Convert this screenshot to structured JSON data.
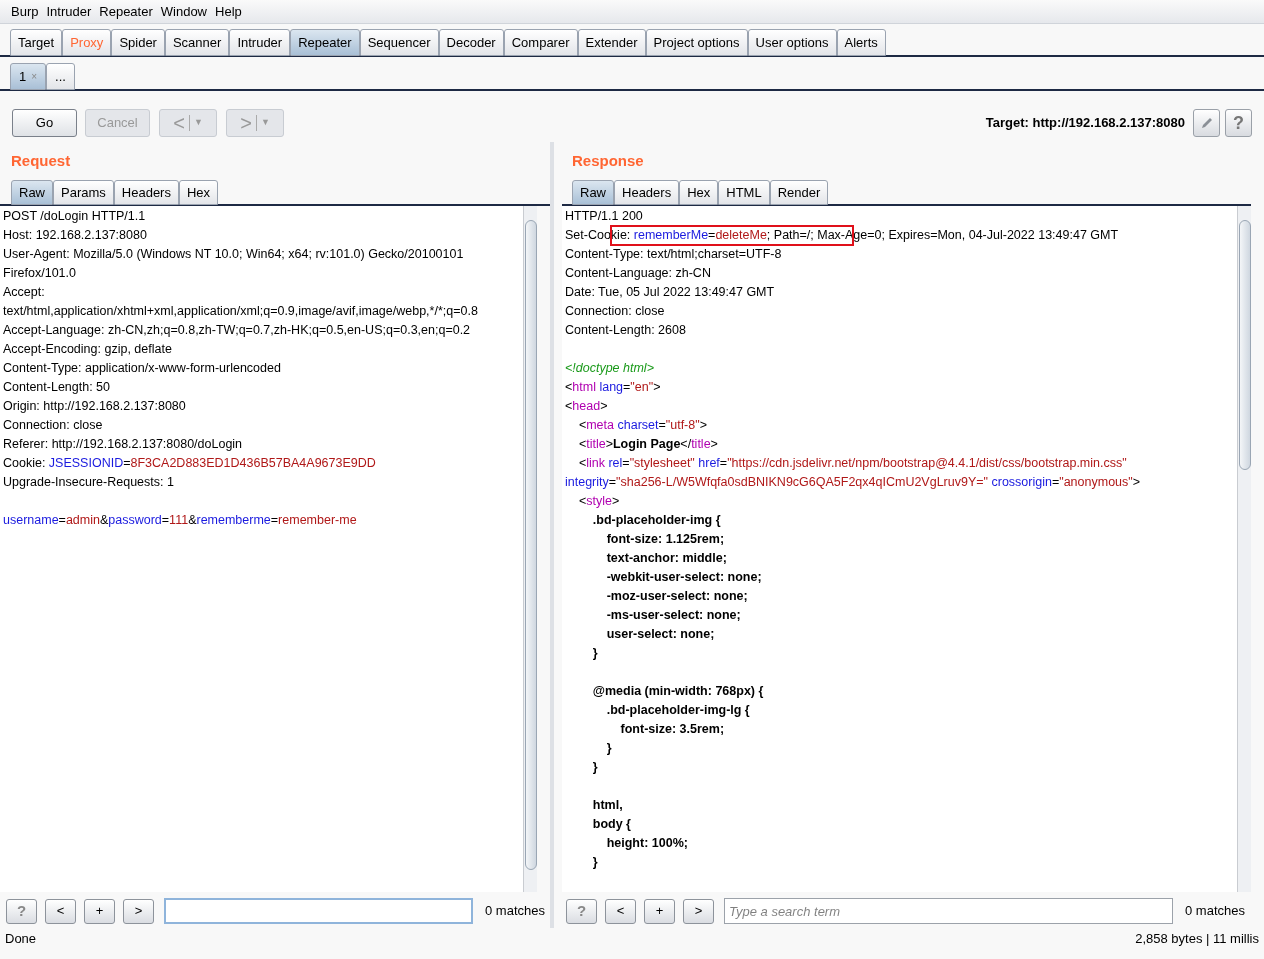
{
  "menu": [
    "Burp",
    "Intruder",
    "Repeater",
    "Window",
    "Help"
  ],
  "tabs": [
    {
      "label": "Target",
      "selected": false,
      "highlighted": false
    },
    {
      "label": "Proxy",
      "selected": false,
      "highlighted": true
    },
    {
      "label": "Spider",
      "selected": false,
      "highlighted": false
    },
    {
      "label": "Scanner",
      "selected": false,
      "highlighted": false
    },
    {
      "label": "Intruder",
      "selected": false,
      "highlighted": false
    },
    {
      "label": "Repeater",
      "selected": true,
      "highlighted": false
    },
    {
      "label": "Sequencer",
      "selected": false,
      "highlighted": false
    },
    {
      "label": "Decoder",
      "selected": false,
      "highlighted": false
    },
    {
      "label": "Comparer",
      "selected": false,
      "highlighted": false
    },
    {
      "label": "Extender",
      "selected": false,
      "highlighted": false
    },
    {
      "label": "Project options",
      "selected": false,
      "highlighted": false
    },
    {
      "label": "User options",
      "selected": false,
      "highlighted": false
    },
    {
      "label": "Alerts",
      "selected": false,
      "highlighted": false
    }
  ],
  "repeater_tabs": [
    {
      "label": "1",
      "close": "×",
      "selected": true
    },
    {
      "label": "...",
      "selected": false
    }
  ],
  "toolbar": {
    "go": {
      "label": "Go",
      "disabled": false
    },
    "cancel": {
      "label": "Cancel",
      "disabled": true
    },
    "back": {
      "arrow": "<",
      "caret": "▼",
      "disabled": true
    },
    "forward": {
      "arrow": ">",
      "caret": "▼",
      "disabled": true
    },
    "target": "Target: http://192.168.2.137:8080",
    "help": "?"
  },
  "request": {
    "title": "Request",
    "tabs": [
      {
        "label": "Raw",
        "selected": true
      },
      {
        "label": "Params",
        "selected": false
      },
      {
        "label": "Headers",
        "selected": false
      },
      {
        "label": "Hex",
        "selected": false
      }
    ],
    "lines": [
      {
        "kind": "code",
        "segments": [
          {
            "kind": "plain",
            "text": "POST /doLogin HTTP/1.1"
          }
        ]
      },
      {
        "kind": "code",
        "segments": [
          {
            "kind": "plain",
            "text": "Host: 192.168.2.137:8080"
          }
        ]
      },
      {
        "kind": "code",
        "segments": [
          {
            "kind": "plain",
            "text": "User-Agent: Mozilla/5.0 (Windows NT 10.0; Win64; x64; rv:101.0) Gecko/20100101"
          }
        ]
      },
      {
        "kind": "code",
        "segments": [
          {
            "kind": "plain",
            "text": "Firefox/101.0"
          }
        ]
      },
      {
        "kind": "code",
        "segments": [
          {
            "kind": "plain",
            "text": "Accept:"
          }
        ]
      },
      {
        "kind": "code",
        "segments": [
          {
            "kind": "plain",
            "text": "text/html,application/xhtml+xml,application/xml;q=0.9,image/avif,image/webp,*/*;q=0.8"
          }
        ]
      },
      {
        "kind": "code",
        "segments": [
          {
            "kind": "plain",
            "text": "Accept-Language: zh-CN,zh;q=0.8,zh-TW;q=0.7,zh-HK;q=0.5,en-US;q=0.3,en;q=0.2"
          }
        ]
      },
      {
        "kind": "code",
        "segments": [
          {
            "kind": "plain",
            "text": "Accept-Encoding: gzip, deflate"
          }
        ]
      },
      {
        "kind": "code",
        "segments": [
          {
            "kind": "plain",
            "text": "Content-Type: application/x-www-form-urlencoded"
          }
        ]
      },
      {
        "kind": "code",
        "segments": [
          {
            "kind": "plain",
            "text": "Content-Length: 50"
          }
        ]
      },
      {
        "kind": "code",
        "segments": [
          {
            "kind": "plain",
            "text": "Origin: http://192.168.2.137:8080"
          }
        ]
      },
      {
        "kind": "code",
        "segments": [
          {
            "kind": "plain",
            "text": "Connection: close"
          }
        ]
      },
      {
        "kind": "code",
        "segments": [
          {
            "kind": "plain",
            "text": "Referer: http://192.168.2.137:8080/doLogin"
          }
        ]
      },
      {
        "kind": "code",
        "segments": [
          {
            "kind": "plain",
            "text": "Cookie: "
          },
          {
            "kind": "name",
            "text": "JSESSIONID"
          },
          {
            "kind": "plain",
            "text": "="
          },
          {
            "kind": "value",
            "text": "8F3CA2D883ED1D436B57BA4A9673E9DD"
          }
        ]
      },
      {
        "kind": "code",
        "segments": [
          {
            "kind": "plain",
            "text": "Upgrade-Insecure-Requests: 1"
          }
        ]
      },
      {
        "kind": "blank"
      },
      {
        "kind": "code",
        "segments": [
          {
            "kind": "name",
            "text": "username"
          },
          {
            "kind": "plain",
            "text": "="
          },
          {
            "kind": "value",
            "text": "admin"
          },
          {
            "kind": "plain",
            "text": "&"
          },
          {
            "kind": "name",
            "text": "password"
          },
          {
            "kind": "plain",
            "text": "="
          },
          {
            "kind": "value",
            "text": "111"
          },
          {
            "kind": "plain",
            "text": "&"
          },
          {
            "kind": "name",
            "text": "rememberme"
          },
          {
            "kind": "plain",
            "text": "="
          },
          {
            "kind": "value",
            "text": "remember-me"
          }
        ]
      }
    ],
    "search": {
      "buttons": [
        "?",
        "<",
        "+",
        ">"
      ],
      "focused": true,
      "matches": "0 matches"
    }
  },
  "response": {
    "title": "Response",
    "tabs": [
      {
        "label": "Raw",
        "selected": true
      },
      {
        "label": "Headers",
        "selected": false
      },
      {
        "label": "Hex",
        "selected": false
      },
      {
        "label": "HTML",
        "selected": false
      },
      {
        "label": "Render",
        "selected": false
      }
    ],
    "lines": [
      {
        "kind": "code",
        "boxed": false,
        "segments": [
          {
            "kind": "plain",
            "text": "HTTP/1.1 200"
          }
        ]
      },
      {
        "kind": "code",
        "boxed": true,
        "segments": [
          {
            "kind": "plain",
            "text": "Set-Cookie: "
          },
          {
            "kind": "name",
            "text": "rememberMe"
          },
          {
            "kind": "plain",
            "text": "="
          },
          {
            "kind": "value",
            "text": "deleteMe"
          },
          {
            "kind": "plain",
            "text": "; Path=/; Max-Age=0; Expires=Mon, 04-Jul-2022 13:49:47 GMT"
          }
        ]
      },
      {
        "kind": "code",
        "boxed": false,
        "segments": [
          {
            "kind": "plain",
            "text": "Content-Type: text/html;charset=UTF-8"
          }
        ]
      },
      {
        "kind": "code",
        "boxed": false,
        "segments": [
          {
            "kind": "plain",
            "text": "Content-Language: zh-CN"
          }
        ]
      },
      {
        "kind": "code",
        "boxed": false,
        "segments": [
          {
            "kind": "plain",
            "text": "Date: Tue, 05 Jul 2022 13:49:47 GMT"
          }
        ]
      },
      {
        "kind": "code",
        "boxed": false,
        "segments": [
          {
            "kind": "plain",
            "text": "Connection: close"
          }
        ]
      },
      {
        "kind": "code",
        "boxed": false,
        "segments": [
          {
            "kind": "plain",
            "text": "Content-Length: 2608"
          }
        ]
      },
      {
        "kind": "blank"
      },
      {
        "kind": "code",
        "boxed": false,
        "segments": [
          {
            "kind": "comment",
            "text": "<!doctype html>"
          }
        ]
      },
      {
        "kind": "code",
        "boxed": false,
        "segments": [
          {
            "kind": "plain",
            "text": "<"
          },
          {
            "kind": "tag",
            "text": "html"
          },
          {
            "kind": "name",
            "text": " lang"
          },
          {
            "kind": "plain",
            "text": "="
          },
          {
            "kind": "value",
            "text": "\"en\""
          },
          {
            "kind": "plain",
            "text": ">"
          }
        ]
      },
      {
        "kind": "code",
        "boxed": false,
        "segments": [
          {
            "kind": "plain",
            "text": "<"
          },
          {
            "kind": "tag",
            "text": "head"
          },
          {
            "kind": "plain",
            "text": ">"
          }
        ]
      },
      {
        "kind": "code",
        "boxed": false,
        "segments": [
          {
            "kind": "plain",
            "text": "    <"
          },
          {
            "kind": "tag",
            "text": "meta"
          },
          {
            "kind": "name",
            "text": " charset"
          },
          {
            "kind": "plain",
            "text": "="
          },
          {
            "kind": "value",
            "text": "\"utf-8\""
          },
          {
            "kind": "plain",
            "text": ">"
          }
        ]
      },
      {
        "kind": "code",
        "boxed": false,
        "segments": [
          {
            "kind": "plain",
            "text": "    <"
          },
          {
            "kind": "tag",
            "text": "title"
          },
          {
            "kind": "plain",
            "text": ">"
          },
          {
            "kind": "bold",
            "text": "Login Page"
          },
          {
            "kind": "plain",
            "text": "</"
          },
          {
            "kind": "tag",
            "text": "title"
          },
          {
            "kind": "plain",
            "text": ">"
          }
        ]
      },
      {
        "kind": "code",
        "boxed": false,
        "segments": [
          {
            "kind": "plain",
            "text": "    <"
          },
          {
            "kind": "tag",
            "text": "link"
          },
          {
            "kind": "name",
            "text": " rel"
          },
          {
            "kind": "plain",
            "text": "="
          },
          {
            "kind": "value",
            "text": "\"stylesheet\""
          },
          {
            "kind": "name",
            "text": " href"
          },
          {
            "kind": "plain",
            "text": "="
          },
          {
            "kind": "value",
            "text": "\"https://cdn.jsdelivr.net/npm/bootstrap@4.4.1/dist/css/bootstrap.min.css\""
          }
        ]
      },
      {
        "kind": "code",
        "boxed": false,
        "segments": [
          {
            "kind": "name",
            "text": "integrity"
          },
          {
            "kind": "plain",
            "text": "="
          },
          {
            "kind": "value",
            "text": "\"sha256-L/W5Wfqfa0sdBNIKN9cG6QA5F2qx4qICmU2VgLruv9Y=\""
          },
          {
            "kind": "name",
            "text": " crossorigin"
          },
          {
            "kind": "plain",
            "text": "="
          },
          {
            "kind": "value",
            "text": "\"anonymous\""
          },
          {
            "kind": "plain",
            "text": ">"
          }
        ]
      },
      {
        "kind": "code",
        "boxed": false,
        "segments": [
          {
            "kind": "plain",
            "text": "    <"
          },
          {
            "kind": "tag",
            "text": "style"
          },
          {
            "kind": "plain",
            "text": ">"
          }
        ]
      },
      {
        "kind": "code",
        "boxed": false,
        "segments": [
          {
            "kind": "bold",
            "text": "        .bd-placeholder-img {"
          }
        ]
      },
      {
        "kind": "code",
        "boxed": false,
        "segments": [
          {
            "kind": "bold",
            "text": "            font-size: 1.125rem;"
          }
        ]
      },
      {
        "kind": "code",
        "boxed": false,
        "segments": [
          {
            "kind": "bold",
            "text": "            text-anchor: middle;"
          }
        ]
      },
      {
        "kind": "code",
        "boxed": false,
        "segments": [
          {
            "kind": "bold",
            "text": "            -webkit-user-select: none;"
          }
        ]
      },
      {
        "kind": "code",
        "boxed": false,
        "segments": [
          {
            "kind": "bold",
            "text": "            -moz-user-select: none;"
          }
        ]
      },
      {
        "kind": "code",
        "boxed": false,
        "segments": [
          {
            "kind": "bold",
            "text": "            -ms-user-select: none;"
          }
        ]
      },
      {
        "kind": "code",
        "boxed": false,
        "segments": [
          {
            "kind": "bold",
            "text": "            user-select: none;"
          }
        ]
      },
      {
        "kind": "code",
        "boxed": false,
        "segments": [
          {
            "kind": "bold",
            "text": "        }"
          }
        ]
      },
      {
        "kind": "blank"
      },
      {
        "kind": "code",
        "boxed": false,
        "segments": [
          {
            "kind": "bold",
            "text": "        @media (min-width: 768px) {"
          }
        ]
      },
      {
        "kind": "code",
        "boxed": false,
        "segments": [
          {
            "kind": "bold",
            "text": "            .bd-placeholder-img-lg {"
          }
        ]
      },
      {
        "kind": "code",
        "boxed": false,
        "segments": [
          {
            "kind": "bold",
            "text": "                font-size: 3.5rem;"
          }
        ]
      },
      {
        "kind": "code",
        "boxed": false,
        "segments": [
          {
            "kind": "bold",
            "text": "            }"
          }
        ]
      },
      {
        "kind": "code",
        "boxed": false,
        "segments": [
          {
            "kind": "bold",
            "text": "        }"
          }
        ]
      },
      {
        "kind": "blank"
      },
      {
        "kind": "code",
        "boxed": false,
        "segments": [
          {
            "kind": "bold",
            "text": "        html,"
          }
        ]
      },
      {
        "kind": "code",
        "boxed": false,
        "segments": [
          {
            "kind": "bold",
            "text": "        body {"
          }
        ]
      },
      {
        "kind": "code",
        "boxed": false,
        "segments": [
          {
            "kind": "bold",
            "text": "            height: 100%;"
          }
        ]
      },
      {
        "kind": "code",
        "boxed": false,
        "segments": [
          {
            "kind": "bold",
            "text": "        }"
          }
        ]
      }
    ],
    "search": {
      "buttons": [
        "?",
        "<",
        "+",
        ">"
      ],
      "placeholder": "Type a search term",
      "focused": false,
      "matches": "0 matches"
    }
  },
  "status_bar": {
    "left": "Done",
    "right": "2,858 bytes | 11 millis"
  }
}
